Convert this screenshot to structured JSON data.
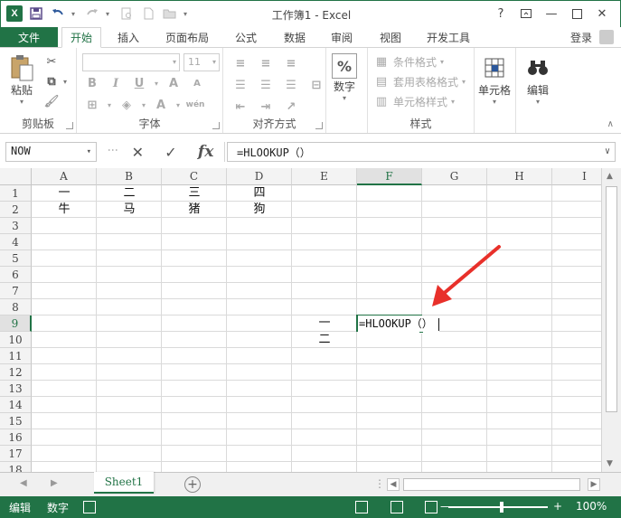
{
  "window": {
    "title": "工作簿1 - Excel",
    "help": "?",
    "ribbon_display": "□",
    "minimize": "—",
    "restore": "□",
    "close": "✕"
  },
  "qat": {
    "logo": "X",
    "save_icon": "save-icon",
    "undo_icon": "undo-icon",
    "redo_icon": "redo-icon"
  },
  "tabs": {
    "file": "文件",
    "items": [
      "开始",
      "插入",
      "页面布局",
      "公式",
      "数据",
      "审阅",
      "视图",
      "开发工具"
    ],
    "login": "登录"
  },
  "ribbon": {
    "clipboard": {
      "paste": "粘贴",
      "label": "剪贴板"
    },
    "font": {
      "size": "11",
      "label": "字体"
    },
    "alignment": {
      "label": "对齐方式"
    },
    "number": {
      "big": "数字",
      "symbol": "%"
    },
    "styles": {
      "conditional": "条件格式",
      "table_format": "套用表格格式",
      "cell_styles": "单元格样式",
      "label": "样式"
    },
    "cells": {
      "big": "单元格"
    },
    "editing": {
      "big": "编辑"
    }
  },
  "formula_bar": {
    "name_box": "NOW",
    "cancel": "✕",
    "enter": "✓",
    "fx": "fx",
    "content": "=HLOOKUP（）"
  },
  "grid": {
    "columns": [
      "A",
      "B",
      "C",
      "D",
      "E",
      "F",
      "G",
      "H",
      "I"
    ],
    "rows": [
      "1",
      "2",
      "3",
      "4",
      "5",
      "6",
      "7",
      "8",
      "9",
      "10",
      "11",
      "12",
      "13",
      "14",
      "15",
      "16",
      "17",
      "18"
    ],
    "selected_column": "F",
    "selected_row": "9",
    "cells": {
      "A1": "一",
      "B1": "二",
      "C1": "三",
      "D1": "四",
      "A2": "牛",
      "B2": "马",
      "C2": "猪",
      "D2": "狗",
      "E9": "一",
      "E10": "二"
    },
    "editing_cell_text": "=HLOOKUP（）"
  },
  "sheets": {
    "tabs": [
      "Sheet1"
    ],
    "add": "+"
  },
  "status": {
    "mode": "编辑",
    "num": "数字",
    "zoom": "100%",
    "zoom_minus": "—",
    "zoom_plus": "+"
  },
  "colors": {
    "accent": "#217346",
    "arrow": "#e8302a"
  }
}
